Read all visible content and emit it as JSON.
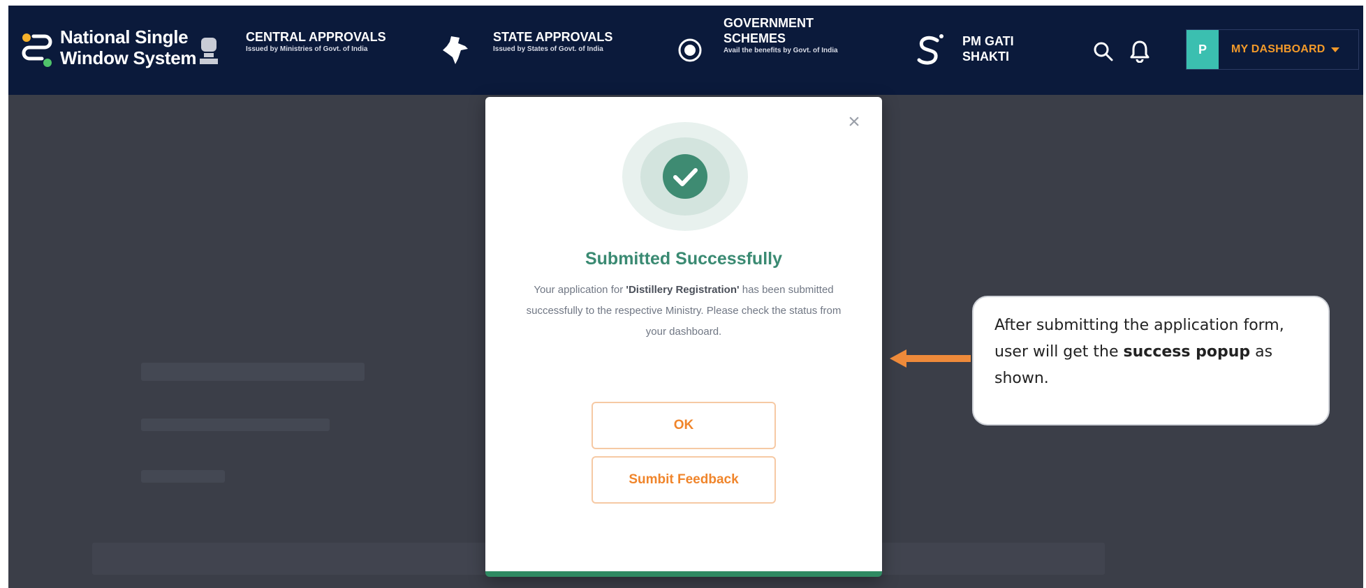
{
  "nav": {
    "brand_line1": "National Single",
    "brand_line2": "Window System",
    "items": [
      {
        "title": "CENTRAL APPROVALS",
        "sub": "Issued by Ministries of Govt. of India"
      },
      {
        "title": "STATE APPROVALS",
        "sub": "Issued by States of Govt. of India"
      },
      {
        "title1": "GOVERNMENT",
        "title2": "SCHEMES",
        "sub": "Avail the benefits by Govt. of India"
      },
      {
        "title1": "PM GATI",
        "title2": "SHAKTI"
      }
    ],
    "avatar_letter": "P",
    "dashboard_label": "MY DASHBOARD"
  },
  "modal": {
    "title": "Submitted Successfully",
    "msg_pre": "Your application for ",
    "msg_bold": "'Distillery Registration'",
    "msg_post": " has been submitted successfully to the respective Ministry. Please check the status from your dashboard.",
    "ok_label": "OK",
    "feedback_label": "Sumbit Feedback",
    "close_glyph": "×"
  },
  "callout": {
    "pre": "After submitting the application form, user will get the ",
    "bold": "success popup",
    "post": " as shown."
  },
  "colors": {
    "nav_bg": "#0b1a3b",
    "overlay": "#3b3e48",
    "accent_orange": "#f39a2a",
    "success_green": "#3a8a72",
    "avatar_teal": "#3bbfb0"
  },
  "icons": [
    "nsws-logo-icon",
    "emblem-icon",
    "india-map-icon",
    "govt-scheme-icon",
    "gati-shakti-icon",
    "search-icon",
    "bell-icon",
    "check-circle-icon",
    "close-icon",
    "arrow-left-icon"
  ]
}
